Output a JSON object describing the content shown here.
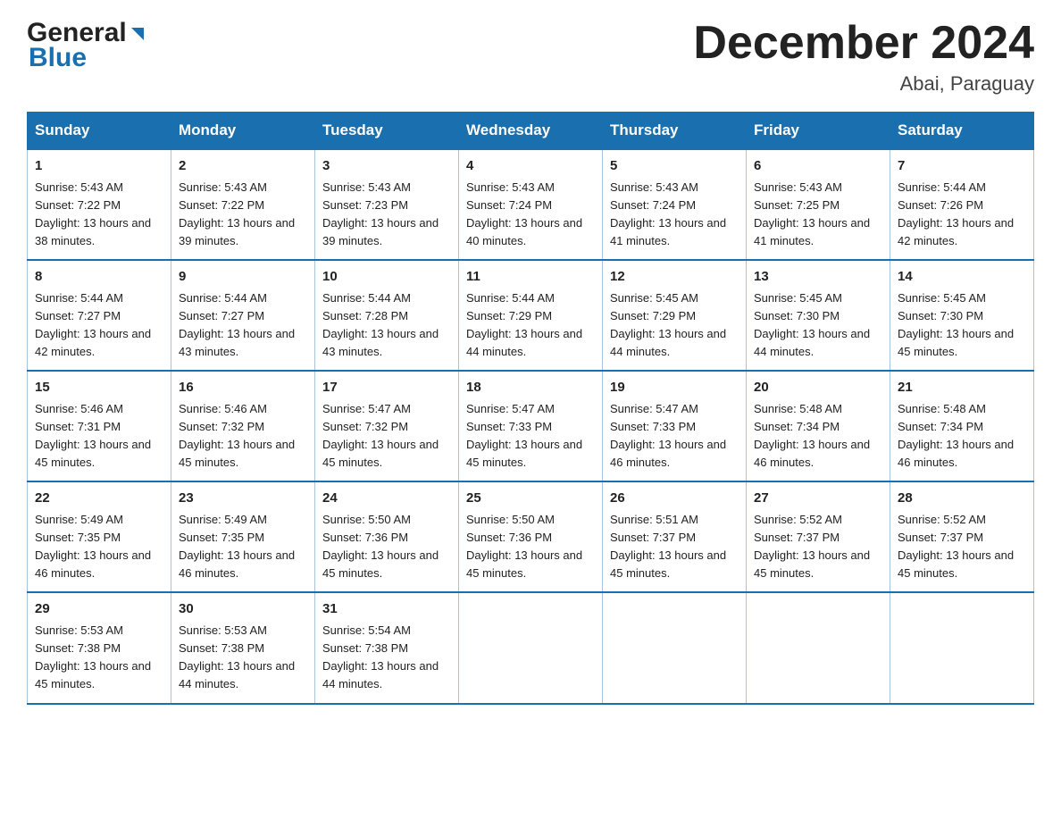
{
  "header": {
    "logo_general": "General",
    "logo_blue": "Blue",
    "month_title": "December 2024",
    "location": "Abai, Paraguay"
  },
  "days_of_week": [
    "Sunday",
    "Monday",
    "Tuesday",
    "Wednesday",
    "Thursday",
    "Friday",
    "Saturday"
  ],
  "weeks": [
    [
      {
        "day": "1",
        "sunrise": "5:43 AM",
        "sunset": "7:22 PM",
        "daylight": "13 hours and 38 minutes."
      },
      {
        "day": "2",
        "sunrise": "5:43 AM",
        "sunset": "7:22 PM",
        "daylight": "13 hours and 39 minutes."
      },
      {
        "day": "3",
        "sunrise": "5:43 AM",
        "sunset": "7:23 PM",
        "daylight": "13 hours and 39 minutes."
      },
      {
        "day": "4",
        "sunrise": "5:43 AM",
        "sunset": "7:24 PM",
        "daylight": "13 hours and 40 minutes."
      },
      {
        "day": "5",
        "sunrise": "5:43 AM",
        "sunset": "7:24 PM",
        "daylight": "13 hours and 41 minutes."
      },
      {
        "day": "6",
        "sunrise": "5:43 AM",
        "sunset": "7:25 PM",
        "daylight": "13 hours and 41 minutes."
      },
      {
        "day": "7",
        "sunrise": "5:44 AM",
        "sunset": "7:26 PM",
        "daylight": "13 hours and 42 minutes."
      }
    ],
    [
      {
        "day": "8",
        "sunrise": "5:44 AM",
        "sunset": "7:27 PM",
        "daylight": "13 hours and 42 minutes."
      },
      {
        "day": "9",
        "sunrise": "5:44 AM",
        "sunset": "7:27 PM",
        "daylight": "13 hours and 43 minutes."
      },
      {
        "day": "10",
        "sunrise": "5:44 AM",
        "sunset": "7:28 PM",
        "daylight": "13 hours and 43 minutes."
      },
      {
        "day": "11",
        "sunrise": "5:44 AM",
        "sunset": "7:29 PM",
        "daylight": "13 hours and 44 minutes."
      },
      {
        "day": "12",
        "sunrise": "5:45 AM",
        "sunset": "7:29 PM",
        "daylight": "13 hours and 44 minutes."
      },
      {
        "day": "13",
        "sunrise": "5:45 AM",
        "sunset": "7:30 PM",
        "daylight": "13 hours and 44 minutes."
      },
      {
        "day": "14",
        "sunrise": "5:45 AM",
        "sunset": "7:30 PM",
        "daylight": "13 hours and 45 minutes."
      }
    ],
    [
      {
        "day": "15",
        "sunrise": "5:46 AM",
        "sunset": "7:31 PM",
        "daylight": "13 hours and 45 minutes."
      },
      {
        "day": "16",
        "sunrise": "5:46 AM",
        "sunset": "7:32 PM",
        "daylight": "13 hours and 45 minutes."
      },
      {
        "day": "17",
        "sunrise": "5:47 AM",
        "sunset": "7:32 PM",
        "daylight": "13 hours and 45 minutes."
      },
      {
        "day": "18",
        "sunrise": "5:47 AM",
        "sunset": "7:33 PM",
        "daylight": "13 hours and 45 minutes."
      },
      {
        "day": "19",
        "sunrise": "5:47 AM",
        "sunset": "7:33 PM",
        "daylight": "13 hours and 46 minutes."
      },
      {
        "day": "20",
        "sunrise": "5:48 AM",
        "sunset": "7:34 PM",
        "daylight": "13 hours and 46 minutes."
      },
      {
        "day": "21",
        "sunrise": "5:48 AM",
        "sunset": "7:34 PM",
        "daylight": "13 hours and 46 minutes."
      }
    ],
    [
      {
        "day": "22",
        "sunrise": "5:49 AM",
        "sunset": "7:35 PM",
        "daylight": "13 hours and 46 minutes."
      },
      {
        "day": "23",
        "sunrise": "5:49 AM",
        "sunset": "7:35 PM",
        "daylight": "13 hours and 46 minutes."
      },
      {
        "day": "24",
        "sunrise": "5:50 AM",
        "sunset": "7:36 PM",
        "daylight": "13 hours and 45 minutes."
      },
      {
        "day": "25",
        "sunrise": "5:50 AM",
        "sunset": "7:36 PM",
        "daylight": "13 hours and 45 minutes."
      },
      {
        "day": "26",
        "sunrise": "5:51 AM",
        "sunset": "7:37 PM",
        "daylight": "13 hours and 45 minutes."
      },
      {
        "day": "27",
        "sunrise": "5:52 AM",
        "sunset": "7:37 PM",
        "daylight": "13 hours and 45 minutes."
      },
      {
        "day": "28",
        "sunrise": "5:52 AM",
        "sunset": "7:37 PM",
        "daylight": "13 hours and 45 minutes."
      }
    ],
    [
      {
        "day": "29",
        "sunrise": "5:53 AM",
        "sunset": "7:38 PM",
        "daylight": "13 hours and 45 minutes."
      },
      {
        "day": "30",
        "sunrise": "5:53 AM",
        "sunset": "7:38 PM",
        "daylight": "13 hours and 44 minutes."
      },
      {
        "day": "31",
        "sunrise": "5:54 AM",
        "sunset": "7:38 PM",
        "daylight": "13 hours and 44 minutes."
      },
      null,
      null,
      null,
      null
    ]
  ]
}
